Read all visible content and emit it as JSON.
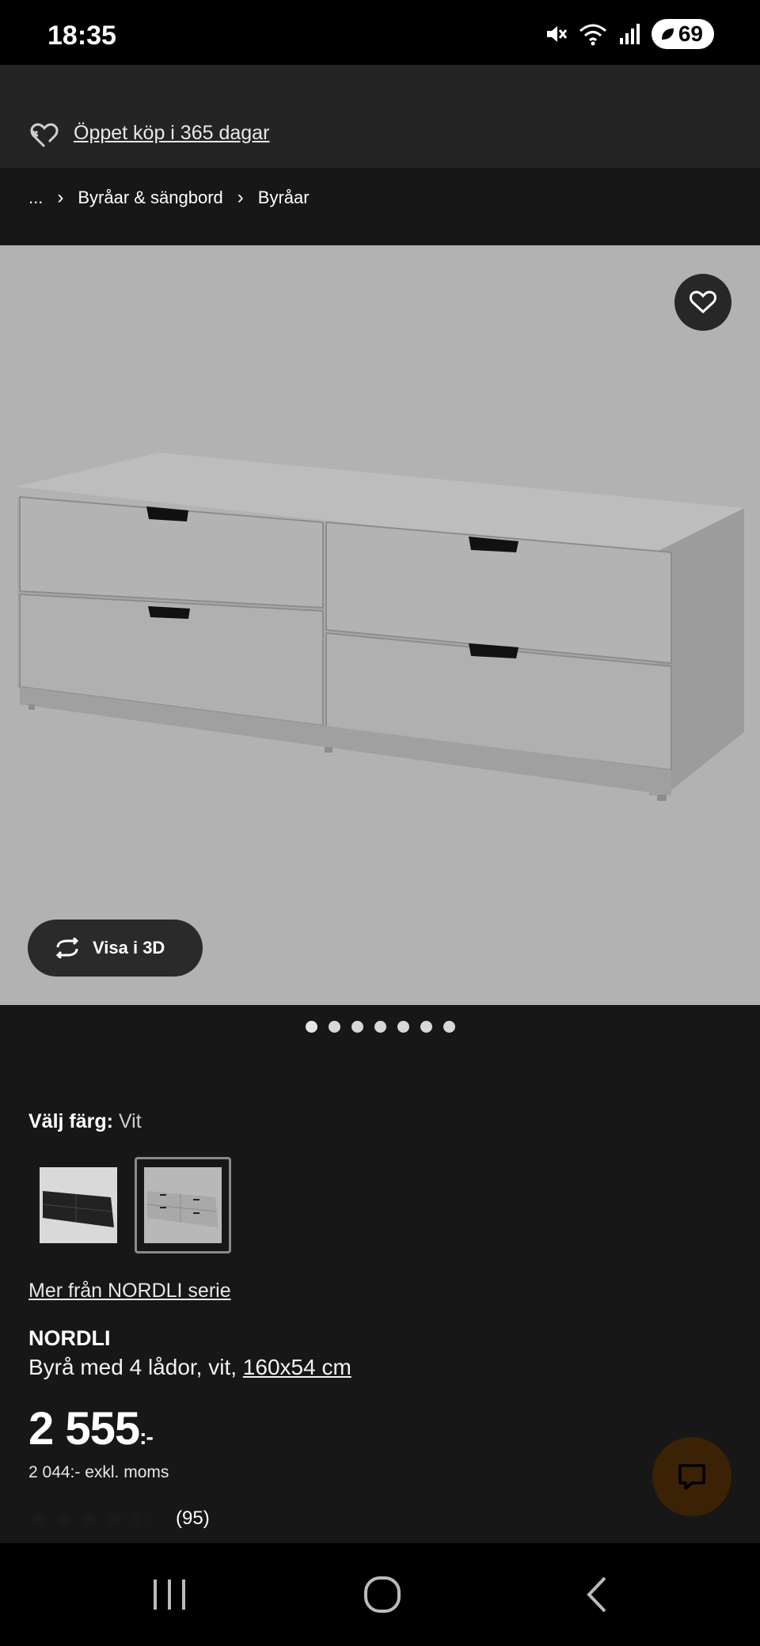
{
  "status_bar": {
    "time": "18:35",
    "battery": "69",
    "icons": [
      "mute-icon",
      "wifi-icon",
      "signal-icon",
      "battery-icon"
    ]
  },
  "header": {
    "return_policy_label": "Öppet köp i 365 dagar"
  },
  "breadcrumb": {
    "ellipsis": "...",
    "items": [
      "Byråar & sängbord",
      "Byråar"
    ]
  },
  "product_gallery": {
    "view_3d_label": "Visa i 3D",
    "dot_count": 7,
    "active_index": 0
  },
  "color_picker": {
    "label": "Välj färg:",
    "selected": "Vit",
    "options": [
      {
        "name": "black",
        "swatch_color": "#1c1c1c"
      },
      {
        "name": "white",
        "swatch_color": "#c8c8c8"
      }
    ]
  },
  "series_link": "Mer från NORDLI serie",
  "product": {
    "name": "NORDLI",
    "description_prefix": "Byrå med 4 lådor, vit, ",
    "size": "160x54 cm",
    "price": "2 555",
    "price_suffix": ":-",
    "price_ex_vat": "2 044:- exkl. moms",
    "rating_value": 4.5,
    "rating_count": "(95)"
  },
  "colors": {
    "background": "#171717",
    "image_bg": "#b2b2b2",
    "chat_button": "#3b2204"
  }
}
